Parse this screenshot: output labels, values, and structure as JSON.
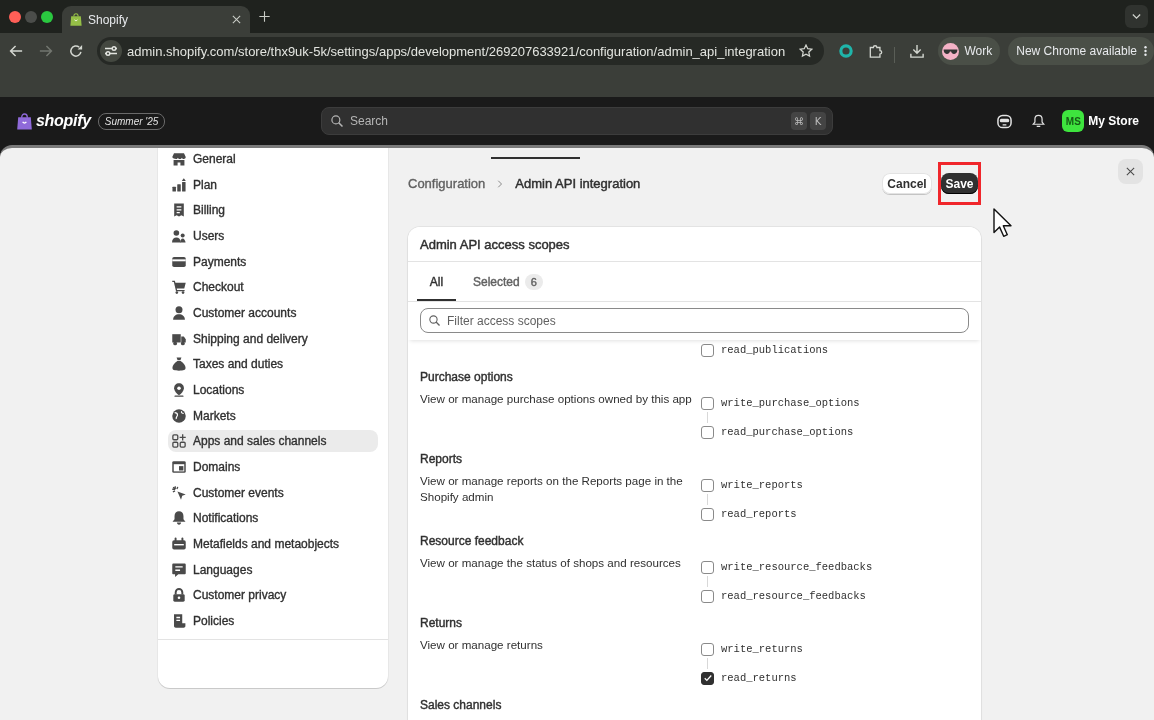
{
  "browser": {
    "tabs": [
      {
        "title": "Shopify",
        "selected": true
      }
    ],
    "navigation": [
      {
        "kind": "back",
        "disabled": false
      },
      {
        "kind": "forward",
        "disabled": true
      },
      {
        "kind": "reload",
        "disabled": false
      }
    ],
    "url": "admin.shopify.com/store/thx9uk-5k/settings/apps/development/269207633921/configuration/admin_api_integration",
    "profile": "Work",
    "update_button": "New Chrome available"
  },
  "topbar": {
    "brand": "shopify",
    "edition_badge": "Summer '25",
    "search": {
      "placeholder": "Search",
      "shortcut_keys": [
        "⌘",
        "K"
      ]
    },
    "store": {
      "initials": "MS",
      "name": "My Store"
    }
  },
  "sidebar": {
    "items": [
      {
        "label": "General",
        "selected": false
      },
      {
        "label": "Plan",
        "selected": false
      },
      {
        "label": "Billing",
        "selected": false
      },
      {
        "label": "Users",
        "selected": false
      },
      {
        "label": "Payments",
        "selected": false
      },
      {
        "label": "Checkout",
        "selected": false
      },
      {
        "label": "Customer accounts",
        "selected": false
      },
      {
        "label": "Shipping and delivery",
        "selected": false
      },
      {
        "label": "Taxes and duties",
        "selected": false
      },
      {
        "label": "Locations",
        "selected": false
      },
      {
        "label": "Markets",
        "selected": false
      },
      {
        "label": "Apps and sales channels",
        "selected": true
      },
      {
        "label": "Domains",
        "selected": false
      },
      {
        "label": "Customer events",
        "selected": false
      },
      {
        "label": "Notifications",
        "selected": false
      },
      {
        "label": "Metafields and metaobjects",
        "selected": false
      },
      {
        "label": "Languages",
        "selected": false
      },
      {
        "label": "Customer privacy",
        "selected": false
      },
      {
        "label": "Policies",
        "selected": false
      }
    ]
  },
  "page_header": {
    "breadcrumb": [
      {
        "label": "Configuration",
        "current": false
      },
      {
        "label": "Admin API integration",
        "current": true
      }
    ],
    "actions": [
      {
        "label": "Cancel",
        "kind": "secondary",
        "highlighted": false
      },
      {
        "label": "Save",
        "kind": "primary",
        "highlighted": true
      }
    ]
  },
  "scopes_card": {
    "title": "Admin API access scopes",
    "tabs": [
      {
        "label": "All",
        "selected": true
      },
      {
        "label": "Selected",
        "count": "6",
        "selected": false
      }
    ],
    "filter": {
      "placeholder": "Filter access scopes"
    },
    "groups": [
      {
        "scopes": [
          {
            "name": "read_publications",
            "checked": false
          }
        ]
      },
      {
        "title": "Purchase options",
        "description": "View or manage purchase options owned by this app",
        "scopes": [
          {
            "name": "write_purchase_options",
            "checked": false
          },
          {
            "name": "read_purchase_options",
            "checked": false
          }
        ]
      },
      {
        "title": "Reports",
        "description": "View or manage reports on the Reports page in the Shopify admin",
        "scopes": [
          {
            "name": "write_reports",
            "checked": false
          },
          {
            "name": "read_reports",
            "checked": false
          }
        ]
      },
      {
        "title": "Resource feedback",
        "description": "View or manage the status of shops and resources",
        "scopes": [
          {
            "name": "write_resource_feedbacks",
            "checked": false
          },
          {
            "name": "read_resource_feedbacks",
            "checked": false
          }
        ]
      },
      {
        "title": "Returns",
        "description": "View or manage returns",
        "scopes": [
          {
            "name": "write_returns",
            "checked": false
          },
          {
            "name": "read_returns",
            "checked": true
          }
        ]
      },
      {
        "title": "Sales channels"
      }
    ]
  }
}
